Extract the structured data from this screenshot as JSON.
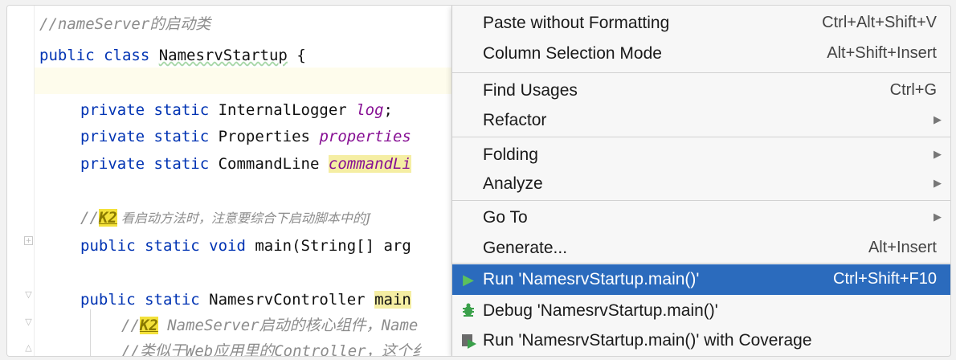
{
  "editor": {
    "lines": {
      "l1": "//nameServer的启动类",
      "l2_kw": "public class ",
      "l2_cls": "NamesrvStartup",
      "l2_end": " {",
      "l4_kw": "private static ",
      "l4_type": "InternalLogger ",
      "l4_field": "log",
      "l4_end": ";",
      "l5_kw": "private static ",
      "l5_type": "Properties ",
      "l5_field": "properties",
      "l6_kw": "private static ",
      "l6_type": "CommandLine ",
      "l6_field": "commandLi",
      "l8_pre": "//",
      "l8_k2": "K2",
      "l8_text": " 看启动方法时，注意要综合下启动脚本中的J",
      "l9_kw": "public static void ",
      "l9_text": "main(String[] arg",
      "l11_kw": "public static ",
      "l11_text": "NamesrvController ",
      "l11_hl": "main",
      "l12_pre": "//",
      "l12_k2": "K2",
      "l12_text": " NameServer启动的核心组件，Name",
      "l13_text": "//类似于Web应用里的Controller，这个纟"
    }
  },
  "context_menu": {
    "items": [
      {
        "label": "Paste without Formatting",
        "u": "w",
        "shortcut": "Ctrl+Alt+Shift+V"
      },
      {
        "label": "Column Selection Mode",
        "shortcut": "Alt+Shift+Insert"
      },
      {
        "label": "Find Usages",
        "shortcut": "Ctrl+G"
      },
      {
        "label": "Refactor",
        "submenu": true
      },
      {
        "label": "Folding",
        "submenu": true
      },
      {
        "label": "Analyze",
        "submenu": true
      },
      {
        "label": "Go To",
        "submenu": true
      },
      {
        "label": "Generate...",
        "shortcut": "Alt+Insert"
      },
      {
        "label": "Run 'NamesrvStartup.main()'",
        "shortcut": "Ctrl+Shift+F10",
        "icon": "run-icon",
        "selected": true
      },
      {
        "label": "Debug 'NamesrvStartup.main()'",
        "icon": "debug-icon"
      },
      {
        "label": "Run 'NamesrvStartup.main()' with Coverage",
        "icon": "coverage-icon"
      }
    ]
  },
  "colors": {
    "selection": "#2b6bbd",
    "keyword": "#0033b3",
    "field": "#871094",
    "comment": "#8c8c8c",
    "k2_highlight": "#f3e13a",
    "run_green": "#3aa04a"
  }
}
